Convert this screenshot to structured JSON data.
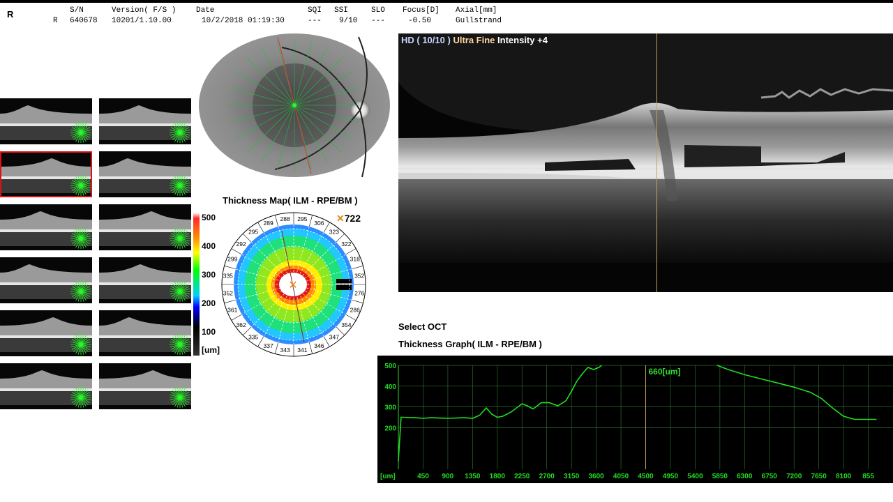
{
  "header": {
    "eye": "R",
    "eye_row": "R",
    "sn_label": "S/N",
    "sn_value": "640678",
    "version_label": "Version( F/S )",
    "version_value": "10201/1.10.00",
    "date_label": "Date",
    "date_value": "10/2/2018 01:19:30",
    "sqi_label": "SQI",
    "sqi_value": "---",
    "ssi_label": "SSI",
    "ssi_value": "9/10",
    "slo_label": "SLO",
    "slo_value": "---",
    "focus_label": "Focus[D]",
    "focus_value": "-0.50",
    "axial_label": "Axial[mm]",
    "axial_value": "Gullstrand"
  },
  "thumbnails": {
    "count": 12,
    "selected_index": 2
  },
  "thickness_map": {
    "title": "Thickness Map( ILM - RPE/BM )",
    "max_value": "722",
    "scale_labels": [
      "500",
      "400",
      "300",
      "200",
      "100",
      "[um]"
    ],
    "outer_values": [
      "295",
      "306",
      "323",
      "322",
      "318",
      "352",
      "276",
      "286",
      "354",
      "347",
      "346",
      "341",
      "343",
      "337",
      "335",
      "362",
      "361",
      "352",
      "335",
      "299",
      "292",
      "295",
      "289",
      "288"
    ]
  },
  "oct": {
    "hd_label": "HD ( 10/10 )",
    "quality_label": "Ultra Fine",
    "intensity_label": "Intensity +4",
    "hd_color": "#c8d4ff",
    "quality_color": "#ffd8a0"
  },
  "select_oct_label": "Select OCT",
  "thickness_graph": {
    "title": "Thickness Graph( ILM - RPE/BM )",
    "marker_label": "660[um]",
    "unit_label": "[um]",
    "line_color": "#22dd22"
  },
  "chart_data": {
    "type": "line",
    "title": "Thickness Graph( ILM - RPE/BM )",
    "xlabel": "[um]",
    "ylabel": "",
    "xlim": [
      0,
      9000
    ],
    "ylim": [
      0,
      500
    ],
    "x_ticks": [
      450,
      900,
      1350,
      1800,
      2250,
      2700,
      3150,
      3600,
      4050,
      4500,
      4950,
      5400,
      5850,
      6300,
      6750,
      7200,
      7650,
      8100,
      8550
    ],
    "x_tick_labels": [
      "450",
      "900",
      "1350",
      "1800",
      "2250",
      "2700",
      "3150",
      "3600",
      "4050",
      "4500",
      "4950",
      "5400",
      "5850",
      "6300",
      "6750",
      "7200",
      "7650",
      "8100",
      "855"
    ],
    "y_ticks": [
      200,
      300,
      400,
      500
    ],
    "grid": true,
    "cursor_x": 4500,
    "cursor_label": "660[um]",
    "series": [
      {
        "name": "",
        "x": [
          0,
          50,
          100,
          300,
          450,
          600,
          900,
          1200,
          1350,
          1480,
          1600,
          1700,
          1800,
          1900,
          2050,
          2250,
          2350,
          2450,
          2600,
          2750,
          2900,
          3050,
          3150,
          3250,
          3350,
          3450,
          3550,
          3650,
          3700
        ],
        "y": [
          40,
          250,
          250,
          248,
          245,
          248,
          245,
          248,
          245,
          260,
          295,
          265,
          250,
          255,
          275,
          315,
          305,
          290,
          320,
          320,
          305,
          330,
          375,
          425,
          460,
          490,
          480,
          490,
          500
        ]
      },
      {
        "name": "",
        "x": [
          5800,
          6000,
          6300,
          6600,
          6900,
          7200,
          7500,
          7700,
          7900,
          8100,
          8300,
          8550,
          8700
        ],
        "y": [
          500,
          480,
          455,
          435,
          415,
          395,
          370,
          340,
          295,
          255,
          240,
          240,
          240
        ]
      }
    ]
  }
}
